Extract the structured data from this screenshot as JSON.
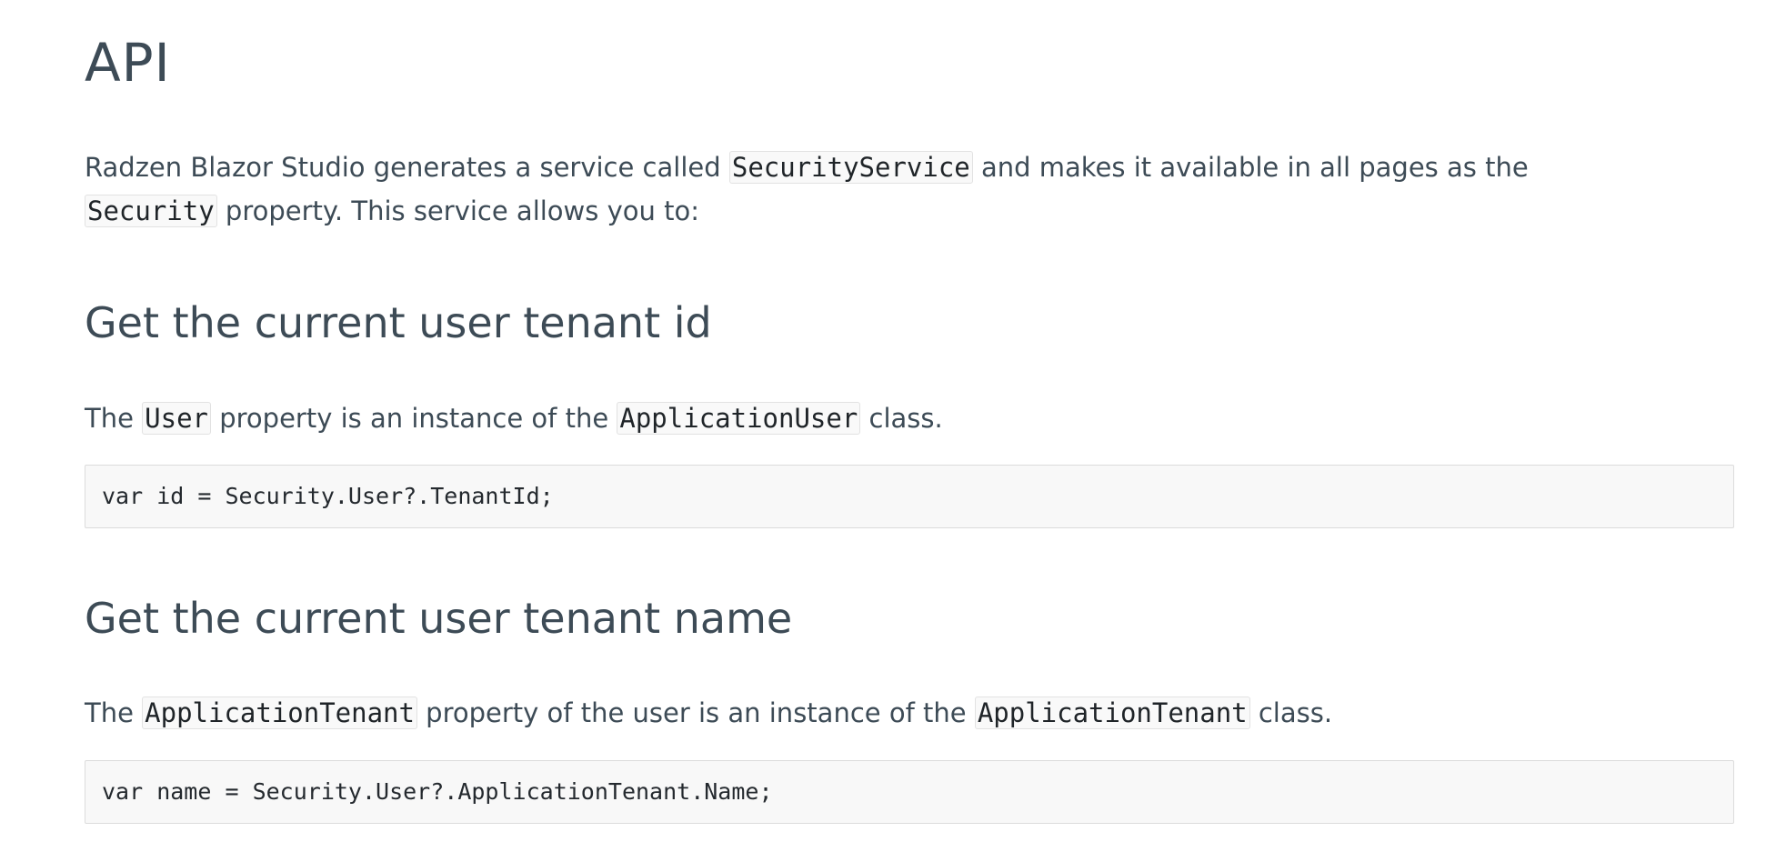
{
  "heading": "API",
  "intro": {
    "text1": "Radzen Blazor Studio generates a service called ",
    "code1": "SecurityService",
    "text2": " and makes it available in all pages as the",
    "code2": "Security",
    "text3": " property. This service allows you to:"
  },
  "sections": [
    {
      "title": "Get the current user tenant id",
      "para": {
        "t1": "The ",
        "c1": "User",
        "t2": " property is an instance of the ",
        "c2": "ApplicationUser",
        "t3": " class."
      },
      "code": "var id = Security.User?.TenantId;"
    },
    {
      "title": "Get the current user tenant name",
      "para": {
        "t1": "The ",
        "c1": "ApplicationTenant",
        "t2": " property of the user is an instance of the ",
        "c2": "ApplicationTenant",
        "t3": " class."
      },
      "code": "var name = Security.User?.ApplicationTenant.Name;"
    }
  ]
}
